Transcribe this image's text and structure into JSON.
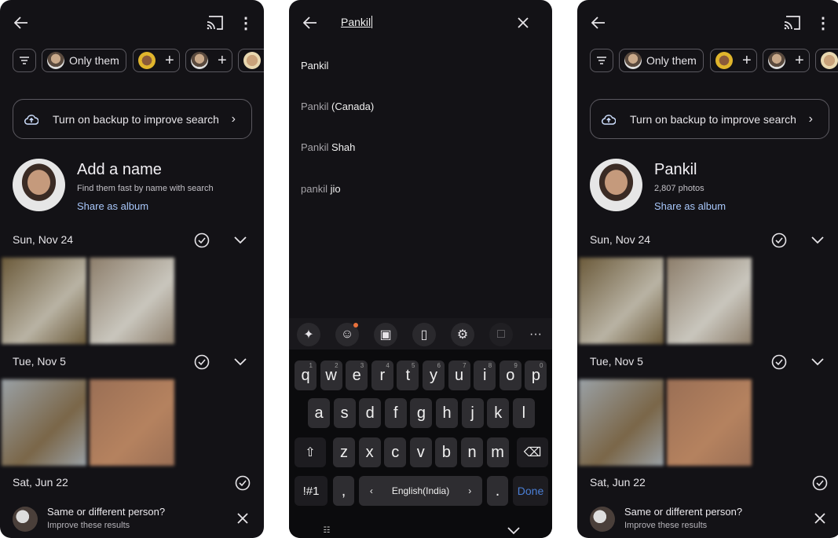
{
  "panels": [
    {
      "id": "p1",
      "filter_chips": {
        "only_them": "Only them",
        "add": "+"
      },
      "backup_banner": "Turn on backup to improve search",
      "person": {
        "title": "Add a name",
        "subtitle": "Find them fast by name with search",
        "share": "Share as album"
      },
      "sections": [
        {
          "date": "Sun, Nov 24"
        },
        {
          "date": "Tue, Nov 5"
        },
        {
          "date": "Sat, Jun 22"
        }
      ],
      "prompt": {
        "title": "Same or different person?",
        "subtitle": "Improve these results"
      }
    },
    {
      "id": "p3",
      "filter_chips": {
        "only_them": "Only them",
        "add": "+"
      },
      "backup_banner": "Turn on backup to improve search",
      "person": {
        "title": "Pankil",
        "subtitle": "2,807 photos",
        "share": "Share as album"
      },
      "sections": [
        {
          "date": "Sun, Nov 24"
        },
        {
          "date": "Tue, Nov 5"
        },
        {
          "date": "Sat, Jun 22"
        }
      ],
      "prompt": {
        "title": "Same or different person?",
        "subtitle": "Improve these results"
      }
    }
  ],
  "search": {
    "query": "Pankil",
    "suggestions": [
      {
        "prefix": "",
        "rest": "Pankil"
      },
      {
        "prefix": "Pankil",
        "rest": " (Canada)"
      },
      {
        "prefix": "Pankil",
        "rest": " Shah"
      },
      {
        "prefix": "pankil",
        "rest": " jio"
      }
    ]
  },
  "keyboard": {
    "rows": [
      [
        "q",
        "w",
        "e",
        "r",
        "t",
        "y",
        "u",
        "i",
        "o",
        "p"
      ],
      [
        "a",
        "s",
        "d",
        "f",
        "g",
        "h",
        "j",
        "k",
        "l"
      ],
      [
        "z",
        "x",
        "c",
        "v",
        "b",
        "n",
        "m"
      ]
    ],
    "numbers": [
      "1",
      "2",
      "3",
      "4",
      "5",
      "6",
      "7",
      "8",
      "9",
      "0"
    ],
    "symbols": "!#1",
    "comma": ",",
    "language": "English(India)",
    "period": ".",
    "done": "Done"
  },
  "colors": {
    "background": "#131216",
    "link": "#a8c7fa",
    "done": "#4a7fd6",
    "badge": "#e8713c"
  }
}
